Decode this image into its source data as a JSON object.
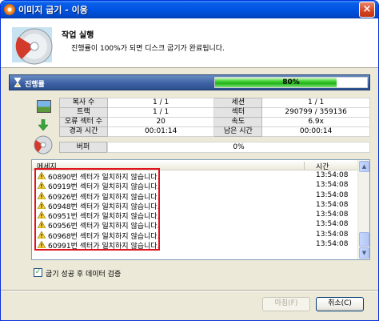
{
  "window": {
    "title": "이미지 굽기 - 이응"
  },
  "header": {
    "title": "작업 실행",
    "description": "진행률이 100%가 되면 디스크 굽기가 완료됩니다."
  },
  "progress": {
    "label": "진행률",
    "value": 0.8,
    "text": "80%"
  },
  "stats": {
    "rows": [
      {
        "l1": "복사 수",
        "v1": "1 / 1",
        "l2": "세션",
        "v2": "1 / 1"
      },
      {
        "l1": "트랙",
        "v1": "1 / 1",
        "l2": "섹터",
        "v2": "290799 / 359136"
      },
      {
        "l1": "오류 섹터 수",
        "v1": "20",
        "l2": "속도",
        "v2": "6.9x"
      },
      {
        "l1": "경과 시간",
        "v1": "00:01:14",
        "l2": "남은 시간",
        "v2": "00:00:14"
      }
    ],
    "buffer_label": "버퍼",
    "buffer_value": "0%"
  },
  "log": {
    "col_message": "메세지",
    "col_time": "시간",
    "rows": [
      {
        "message": "60890번 섹터가 일치하지 않습니다.",
        "time": "13:54:08"
      },
      {
        "message": "60919번 섹터가 일치하지 않습니다.",
        "time": "13:54:08"
      },
      {
        "message": "60926번 섹터가 일치하지 않습니다.",
        "time": "13:54:08"
      },
      {
        "message": "60948번 섹터가 일치하지 않습니다.",
        "time": "13:54:08"
      },
      {
        "message": "60951번 섹터가 일치하지 않습니다.",
        "time": "13:54:08"
      },
      {
        "message": "60956번 섹터가 일치하지 않습니다.",
        "time": "13:54:08"
      },
      {
        "message": "60968번 섹터가 일치하지 않습니다.",
        "time": "13:54:08"
      },
      {
        "message": "60991번 섹터가 일치하지 않습니다.",
        "time": "13:54:08"
      }
    ]
  },
  "verify": {
    "label": "굽기 성공 후 데이터 검증",
    "checked": true
  },
  "buttons": {
    "finish": "마침(F)",
    "cancel": "취소(C)"
  },
  "icons": {
    "app": "disc-burn-icon",
    "header": "disc-icon",
    "progress": "hourglass-icon",
    "source": "image-icon",
    "direction": "arrow-down-icon",
    "target": "disc-icon",
    "warning": "warning-icon"
  },
  "colors": {
    "highlight": "#e0141e",
    "progress_fill": "#23b11a",
    "title_bar": "#0054e3"
  }
}
